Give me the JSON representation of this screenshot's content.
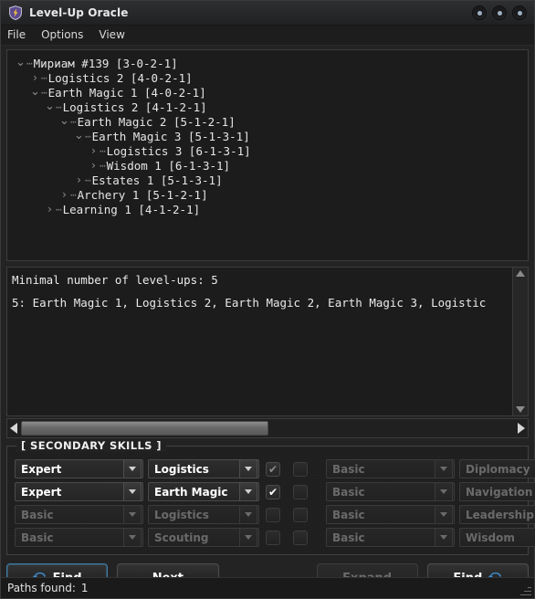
{
  "window": {
    "title": "Level-Up Oracle",
    "icon": "shield-bolt-icon",
    "controls": [
      "minimize-button",
      "maximize-button",
      "close-button"
    ]
  },
  "menubar": {
    "items": [
      {
        "label": "File"
      },
      {
        "label": "Options"
      },
      {
        "label": "View"
      }
    ]
  },
  "tree": {
    "rows": [
      {
        "depth": 0,
        "state": "expanded",
        "label": "Мириам #139 [3-0-2-1]"
      },
      {
        "depth": 1,
        "state": "collapsed",
        "label": "Logistics 2 [4-0-2-1]"
      },
      {
        "depth": 1,
        "state": "expanded",
        "label": "Earth Magic 1 [4-0-2-1]"
      },
      {
        "depth": 2,
        "state": "expanded",
        "label": "Logistics 2 [4-1-2-1]"
      },
      {
        "depth": 3,
        "state": "expanded",
        "label": "Earth Magic 2 [5-1-2-1]"
      },
      {
        "depth": 4,
        "state": "expanded",
        "label": "Earth Magic 3 [5-1-3-1]"
      },
      {
        "depth": 5,
        "state": "collapsed",
        "label": "Logistics 3 [6-1-3-1]"
      },
      {
        "depth": 5,
        "state": "collapsed",
        "label": "Wisdom 1 [6-1-3-1]"
      },
      {
        "depth": 4,
        "state": "collapsed",
        "label": "Estates 1 [5-1-3-1]"
      },
      {
        "depth": 3,
        "state": "collapsed",
        "label": "Archery 1 [5-1-2-1]"
      },
      {
        "depth": 2,
        "state": "collapsed",
        "label": "Learning 1 [4-1-2-1]"
      }
    ]
  },
  "log": {
    "line1": "Minimal number of level-ups: 5",
    "line2": "5: Earth Magic 1, Logistics 2, Earth Magic 2, Earth Magic 3, Logistic"
  },
  "skills": {
    "group_label": "[ SECONDARY SKILLS ]",
    "rows": [
      {
        "left_level": "Expert",
        "left_skill": "Logistics",
        "left_enabled": true,
        "check_a": "checked-dim",
        "check_b": "unchecked",
        "right_level": "Basic",
        "right_skill": "Diplomacy",
        "right_enabled": false
      },
      {
        "left_level": "Expert",
        "left_skill": "Earth Magic",
        "left_enabled": true,
        "check_a": "checked",
        "check_b": "unchecked",
        "right_level": "Basic",
        "right_skill": "Navigation",
        "right_enabled": false
      },
      {
        "left_level": "Basic",
        "left_skill": "Logistics",
        "left_enabled": false,
        "check_a": "unchecked",
        "check_b": "unchecked",
        "right_level": "Basic",
        "right_skill": "Leadership",
        "right_enabled": false
      },
      {
        "left_level": "Basic",
        "left_skill": "Scouting",
        "left_enabled": false,
        "check_a": "unchecked",
        "check_b": "unchecked",
        "right_level": "Basic",
        "right_skill": "Wisdom",
        "right_enabled": false
      }
    ]
  },
  "buttons": {
    "find_primary": "Find",
    "next": "Next",
    "expand": "Expand",
    "find_secondary": "Find"
  },
  "status": {
    "label": "Paths found:",
    "count": "1"
  },
  "colors": {
    "accent_blue": "#3d8fd4",
    "window_bg": "#232323",
    "panel_bg": "#1c1c1c",
    "text": "#e6e6e6",
    "disabled_text": "#6a6a6a"
  }
}
